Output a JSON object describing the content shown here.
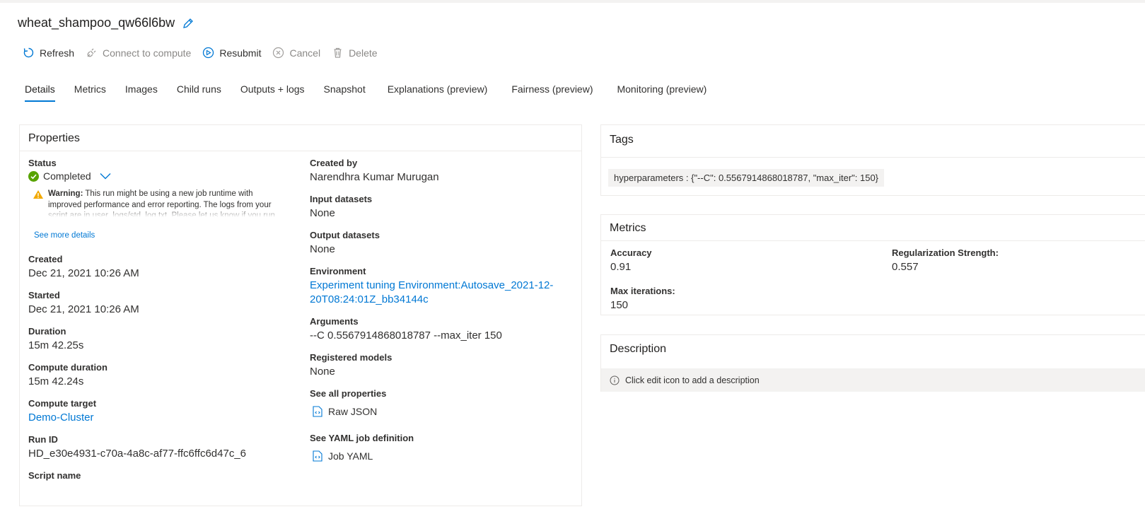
{
  "header": {
    "title": "wheat_shampoo_qw66l6bw"
  },
  "toolbar": {
    "refresh": "Refresh",
    "connect": "Connect to compute",
    "resubmit": "Resubmit",
    "cancel": "Cancel",
    "delete": "Delete"
  },
  "tabs": [
    {
      "label": "Details"
    },
    {
      "label": "Metrics"
    },
    {
      "label": "Images"
    },
    {
      "label": "Child runs"
    },
    {
      "label": "Outputs + logs"
    },
    {
      "label": "Snapshot"
    },
    {
      "label": "Explanations (preview)"
    },
    {
      "label": "Fairness (preview)"
    },
    {
      "label": "Monitoring (preview)"
    }
  ],
  "properties": {
    "heading": "Properties",
    "status_label": "Status",
    "status_value": "Completed",
    "warning_bold": "Warning:",
    "warning_text": " This run might be using a new job runtime with improved performance and error reporting. The logs from your script are in user_logs/std_log.txt. Please let us know if you run into",
    "see_more": "See more details",
    "created_label": "Created",
    "created_value": "Dec 21, 2021 10:26 AM",
    "started_label": "Started",
    "started_value": "Dec 21, 2021 10:26 AM",
    "duration_label": "Duration",
    "duration_value": "15m 42.25s",
    "compute_duration_label": "Compute duration",
    "compute_duration_value": "15m 42.24s",
    "compute_target_label": "Compute target",
    "compute_target_value": "Demo-Cluster",
    "run_id_label": "Run ID",
    "run_id_value": "HD_e30e4931-c70a-4a8c-af77-ffc6ffc6d47c_6",
    "script_name_label": "Script name",
    "created_by_label": "Created by",
    "created_by_value": "Narendhra Kumar Murugan",
    "input_label": "Input datasets",
    "input_value": "None",
    "output_label": "Output datasets",
    "output_value": "None",
    "environment_label": "Environment",
    "environment_value": "Experiment tuning Environment:Autosave_2021-12-20T08:24:01Z_bb34144c",
    "arguments_label": "Arguments",
    "arguments_value": "--C 0.5567914868018787 --max_iter 150",
    "registered_label": "Registered models",
    "registered_value": "None",
    "all_props_label": "See all properties",
    "raw_json": "Raw JSON",
    "yaml_label": "See YAML job definition",
    "job_yaml": "Job YAML"
  },
  "tags": {
    "heading": "Tags",
    "chip": "hyperparameters : {\"--C\": 0.5567914868018787, \"max_iter\": 150}"
  },
  "metrics": {
    "heading": "Metrics",
    "accuracy_label": "Accuracy",
    "accuracy_value": "0.91",
    "reg_label": "Regularization Strength:",
    "reg_value": "0.557",
    "iter_label": "Max iterations:",
    "iter_value": "150"
  },
  "description": {
    "heading": "Description",
    "hint": "Click edit icon to add a description"
  },
  "colors": {
    "accent": "#0078d4",
    "success": "#57a300",
    "warning": "#f2a900"
  }
}
